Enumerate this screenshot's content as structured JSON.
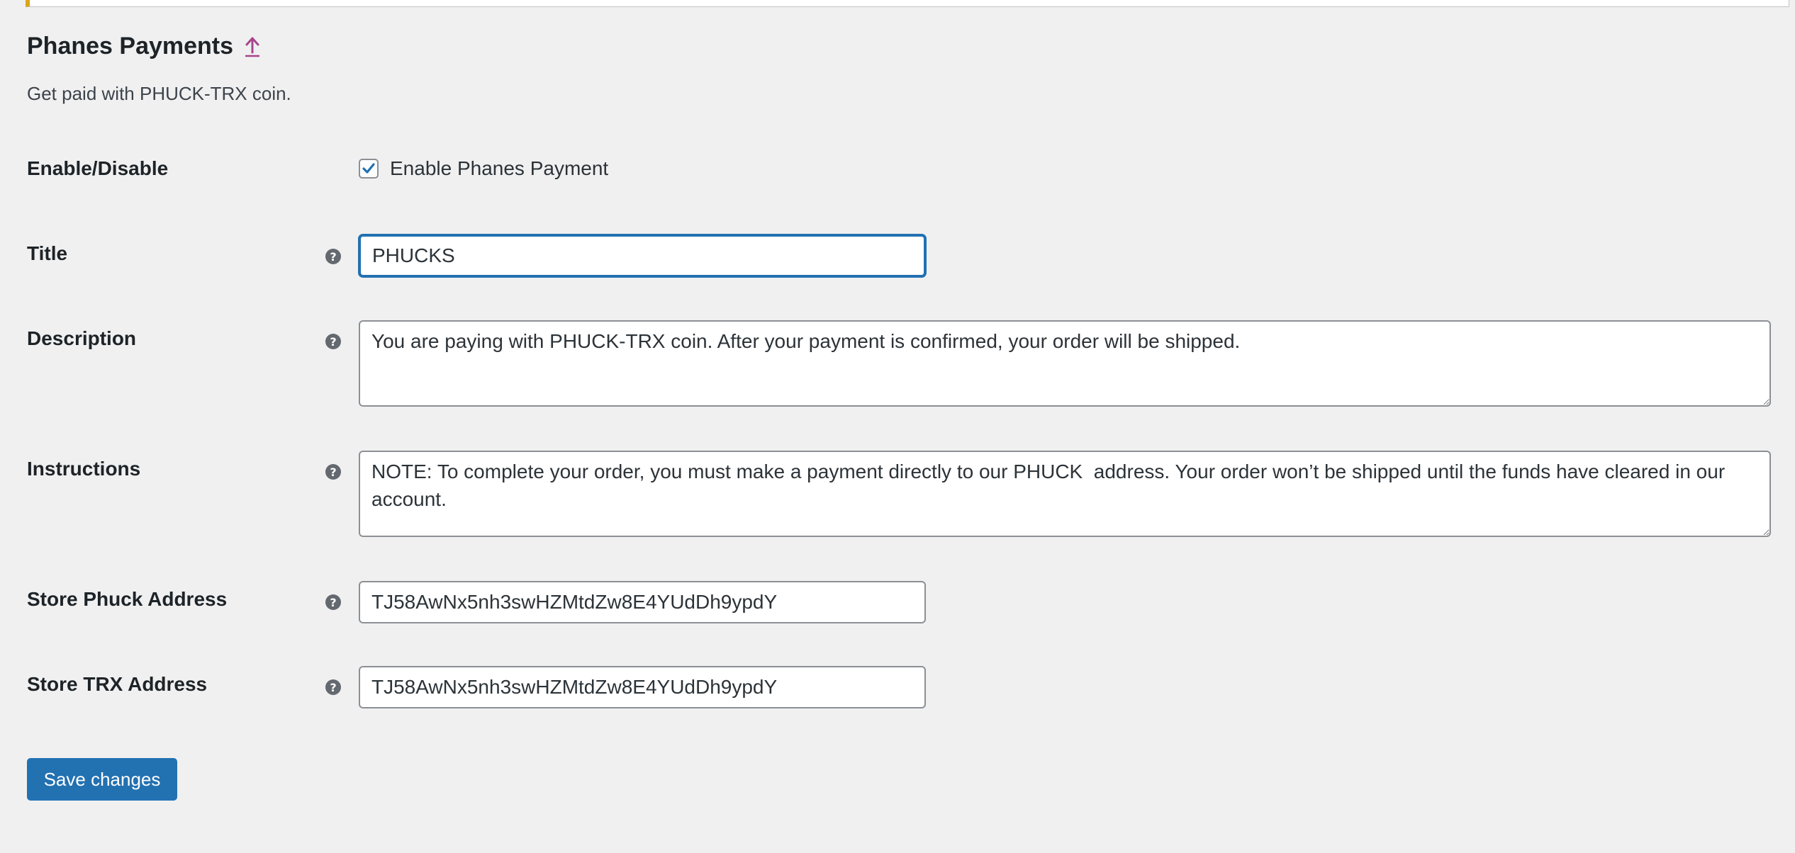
{
  "section": {
    "title": "Phanes Payments",
    "subtitle": "Get paid with PHUCK-TRX coin."
  },
  "fields": {
    "enable": {
      "label": "Enable/Disable",
      "checkbox_label": "Enable Phanes Payment",
      "checked": true
    },
    "title": {
      "label": "Title",
      "help_icon": "?",
      "value": "PHUCKS"
    },
    "description": {
      "label": "Description",
      "help_icon": "?",
      "value": "You are paying with PHUCK-TRX coin. After your payment is confirmed, your order will be shipped."
    },
    "instructions": {
      "label": "Instructions",
      "help_icon": "?",
      "value": "NOTE: To complete your order, you must make a payment directly to our PHUCK  address. Your order won’t be shipped until the funds have cleared in our account."
    },
    "store_phuck_address": {
      "label": "Store Phuck Address",
      "help_icon": "?",
      "value": "TJ58AwNx5nh3swHZMtdZw8E4YUdDh9ypdY"
    },
    "store_trx_address": {
      "label": "Store TRX Address",
      "help_icon": "?",
      "value": "TJ58AwNx5nh3swHZMtdZw8E4YUdDh9ypdY"
    }
  },
  "actions": {
    "save_label": "Save changes"
  },
  "colors": {
    "primary": "#2271b1",
    "link": "#a7458c",
    "notice_warning": "#dba617",
    "background": "#f0f0f1"
  },
  "icons": {
    "up_link": "arrow-up-icon",
    "help": "help-icon",
    "check": "checkmark-icon"
  }
}
